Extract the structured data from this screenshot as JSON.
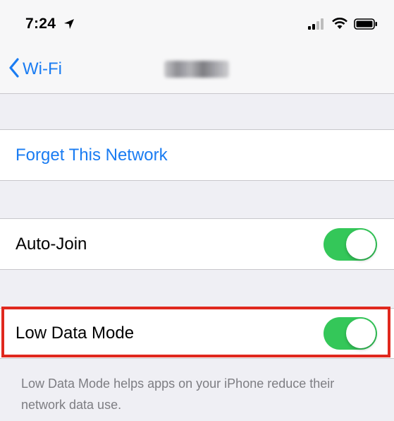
{
  "status_bar": {
    "time": "7:24",
    "icons": [
      "location-arrow-icon",
      "cellular-signal-icon",
      "wifi-icon",
      "battery-icon"
    ]
  },
  "nav": {
    "back_label": "Wi-Fi"
  },
  "sections": {
    "forget_label": "Forget This Network",
    "auto_join": {
      "label": "Auto-Join",
      "enabled": true
    },
    "low_data_mode": {
      "label": "Low Data Mode",
      "enabled": true,
      "highlighted": true
    },
    "footer": "Low Data Mode helps apps on your iPhone reduce their network data use."
  },
  "colors": {
    "accent": "#1a7cf2",
    "toggle_on": "#34c759",
    "highlight": "#e0281e",
    "background": "#efeff4"
  }
}
